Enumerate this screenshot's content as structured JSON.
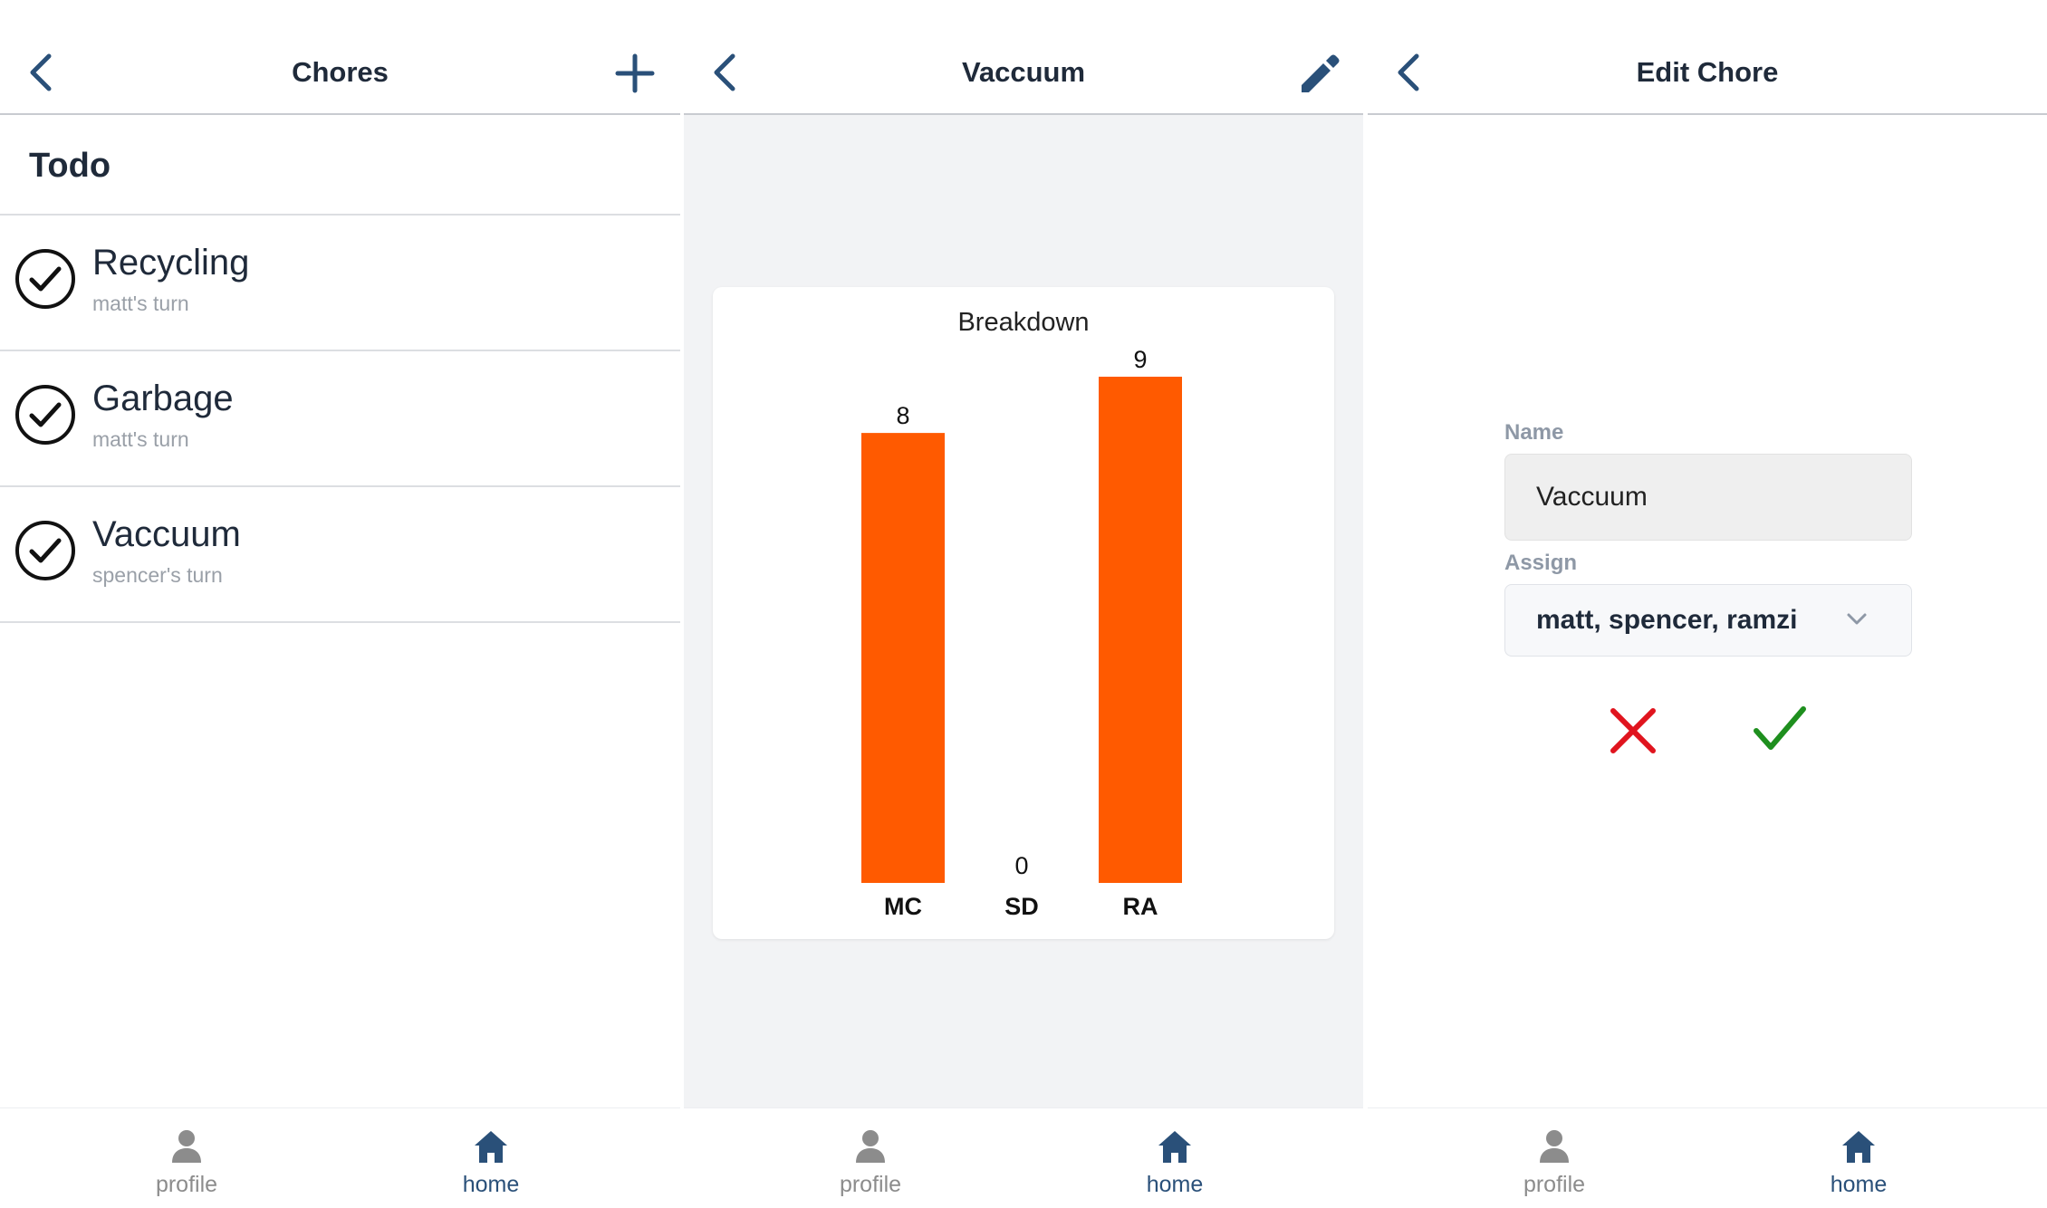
{
  "colors": {
    "accent": "#2a5079",
    "bar": "#ff5a00",
    "cancel": "#e0141e",
    "confirm": "#1e8f1e"
  },
  "list_screen": {
    "title": "Chores",
    "section": "Todo",
    "items": [
      {
        "title": "Recycling",
        "subtitle": "matt's turn"
      },
      {
        "title": "Garbage",
        "subtitle": "matt's turn"
      },
      {
        "title": "Vaccuum",
        "subtitle": "spencer's turn"
      }
    ],
    "icons": {
      "back": "chevron-left-icon",
      "add": "plus-icon",
      "done": "check-circle-icon"
    }
  },
  "detail_screen": {
    "title": "Vaccuum",
    "icons": {
      "back": "chevron-left-icon",
      "edit": "pencil-icon"
    }
  },
  "chart_data": {
    "type": "bar",
    "title": "Breakdown",
    "categories": [
      "MC",
      "SD",
      "RA"
    ],
    "values": [
      8,
      0,
      9
    ],
    "xlabel": "",
    "ylabel": "",
    "ylim": [
      0,
      9
    ],
    "grid": false
  },
  "edit_screen": {
    "title": "Edit Chore",
    "name_label": "Name",
    "name_value": "Vaccuum",
    "assign_label": "Assign",
    "assign_value": "matt, spencer, ramzi",
    "icons": {
      "back": "chevron-left-icon",
      "dropdown": "chevron-down-icon",
      "cancel": "close-icon",
      "confirm": "checkmark-icon"
    }
  },
  "tabbar": {
    "profile_label": "profile",
    "home_label": "home"
  }
}
